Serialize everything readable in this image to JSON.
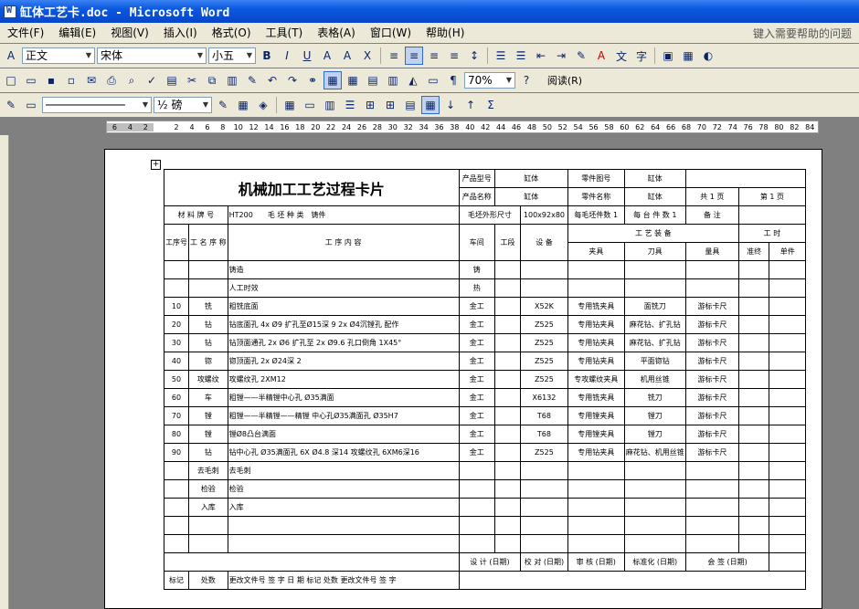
{
  "window": {
    "title": "缸体工艺卡.doc - Microsoft Word"
  },
  "menu": {
    "items": [
      "文件(F)",
      "编辑(E)",
      "视图(V)",
      "插入(I)",
      "格式(O)",
      "工具(T)",
      "表格(A)",
      "窗口(W)",
      "帮助(H)"
    ],
    "help_placeholder": "键入需要帮助的问题"
  },
  "formatting": {
    "style": "正文",
    "font": "宋体",
    "size": "小五"
  },
  "standard": {
    "zoom": "70%",
    "read": "阅读(R)"
  },
  "drawing": {
    "line_width": "½ 磅"
  },
  "ruler": {
    "ticks": [
      "6",
      "4",
      "2",
      "",
      "2",
      "4",
      "6",
      "8",
      "10",
      "12",
      "14",
      "16",
      "18",
      "20",
      "22",
      "24",
      "26",
      "28",
      "30",
      "32",
      "34",
      "36",
      "38",
      "40",
      "42",
      "44",
      "46",
      "48",
      "50",
      "52",
      "54",
      "56",
      "58",
      "60",
      "62",
      "64",
      "66",
      "68",
      "70",
      "72",
      "74",
      "76",
      "78",
      "80",
      "82",
      "84"
    ]
  },
  "card": {
    "title": "机械加工工艺过程卡片",
    "product_model_label": "产品型号",
    "product_model": "缸体",
    "part_code_label": "零件图号",
    "part_code": "缸体",
    "product_name_label": "产品名称",
    "product_name": "缸体",
    "part_name_label": "零件名称",
    "part_name": "缸体",
    "total_label": "共",
    "total": "1",
    "page_unit": "页",
    "page_label": "第",
    "page_no": "1",
    "material_label": "材 料 牌 号",
    "material": "HT200",
    "blank_type_label": "毛 坯 种 类",
    "blank_type": "铸件",
    "blank_size_label": "毛坯外形尺寸",
    "blank_size": "100x92x80",
    "per_blank_label": "每毛坯件数",
    "per_blank": "1",
    "per_machine_label": "每 台 件 数",
    "per_machine": "1",
    "remark_label": "备 注",
    "h_proc_no": "工序号",
    "h_proc_name": "工 名 序 称",
    "h_content": "工 序 内 容",
    "h_workshop": "车间",
    "h_section": "工段",
    "h_equipment": "设 备",
    "h_equip_group": "工 艺 装 备",
    "h_fixture": "夹具",
    "h_tool": "刀具",
    "h_gauge": "量具",
    "h_hours": "工 时",
    "h_prep": "准终",
    "h_unit": "单件",
    "rows": [
      [
        "",
        "",
        "铸造",
        "铸",
        "",
        "",
        "",
        "",
        "",
        ""
      ],
      [
        "",
        "",
        "人工时效",
        "热",
        "",
        "",
        "",
        "",
        "",
        ""
      ],
      [
        "10",
        "铣",
        "粗铣底面",
        "金工",
        "",
        "X52K",
        "专用铣夹具",
        "面铣刀",
        "游标卡尺",
        ""
      ],
      [
        "20",
        "钻",
        "钻底面孔 4x Ø9 扩孔至Ø15深 9 2x Ø4沉镗孔 配作",
        "金工",
        "",
        "Z525",
        "专用钻夹具",
        "麻花钻、扩孔钻",
        "游标卡尺",
        ""
      ],
      [
        "30",
        "钻",
        "钻顶面通孔 2x Ø6 扩孔至 2x Ø9.6 孔口倒角 1X45°",
        "金工",
        "",
        "Z525",
        "专用钻夹具",
        "麻花钻、扩孔钻",
        "游标卡尺",
        ""
      ],
      [
        "40",
        "锪",
        "锪顶面孔 2x Ø24深 2",
        "金工",
        "",
        "Z525",
        "专用钻夹具",
        "平面锪钻",
        "游标卡尺",
        ""
      ],
      [
        "50",
        "攻螺纹",
        "攻螺纹孔 2XM12",
        "金工",
        "",
        "Z525",
        "专攻螺纹夹具",
        "机用丝锥",
        "游标卡尺",
        ""
      ],
      [
        "60",
        "车",
        "粗镗——半精镗中心孔 Ø35满面",
        "金工",
        "",
        "X6132",
        "专用铣夹具",
        "铣刀",
        "游标卡尺",
        ""
      ],
      [
        "70",
        "镗",
        "粗镗——半精镗——精镗 中心孔Ø35满面孔 Ø35H7",
        "金工",
        "",
        "T68",
        "专用镗夹具",
        "镗刀",
        "游标卡尺",
        ""
      ],
      [
        "80",
        "镗",
        "镗Ø8凸台满面",
        "金工",
        "",
        "T68",
        "专用镗夹具",
        "镗刀",
        "游标卡尺",
        ""
      ],
      [
        "90",
        "钻",
        "钻中心孔 Ø35满面孔 6X Ø4.8 深14 攻螺纹孔 6XM6深16",
        "金工",
        "",
        "Z525",
        "专用钻夹具",
        "麻花钻、机用丝锥",
        "游标卡尺",
        ""
      ],
      [
        "",
        "去毛刺",
        "去毛刺",
        "",
        "",
        "",
        "",
        "",
        "",
        ""
      ],
      [
        "",
        "检验",
        "检验",
        "",
        "",
        "",
        "",
        "",
        "",
        ""
      ],
      [
        "",
        "入库",
        "入库",
        "",
        "",
        "",
        "",
        "",
        "",
        ""
      ],
      [
        "",
        "",
        "",
        "",
        "",
        "",
        "",
        "",
        "",
        ""
      ],
      [
        "",
        "",
        "",
        "",
        "",
        "",
        "",
        "",
        "",
        ""
      ]
    ],
    "sign_design": "设 计 (日期)",
    "sign_check": "校 对 (日期)",
    "sign_review": "审 核 (日期)",
    "sign_std": "标准化 (日期)",
    "sign_sign": "会 签 (日期)",
    "f_mark": "标记",
    "f_count": "处数",
    "f_doc": "更改文件号",
    "f_sig": "签 字",
    "f_date": "日 期"
  }
}
